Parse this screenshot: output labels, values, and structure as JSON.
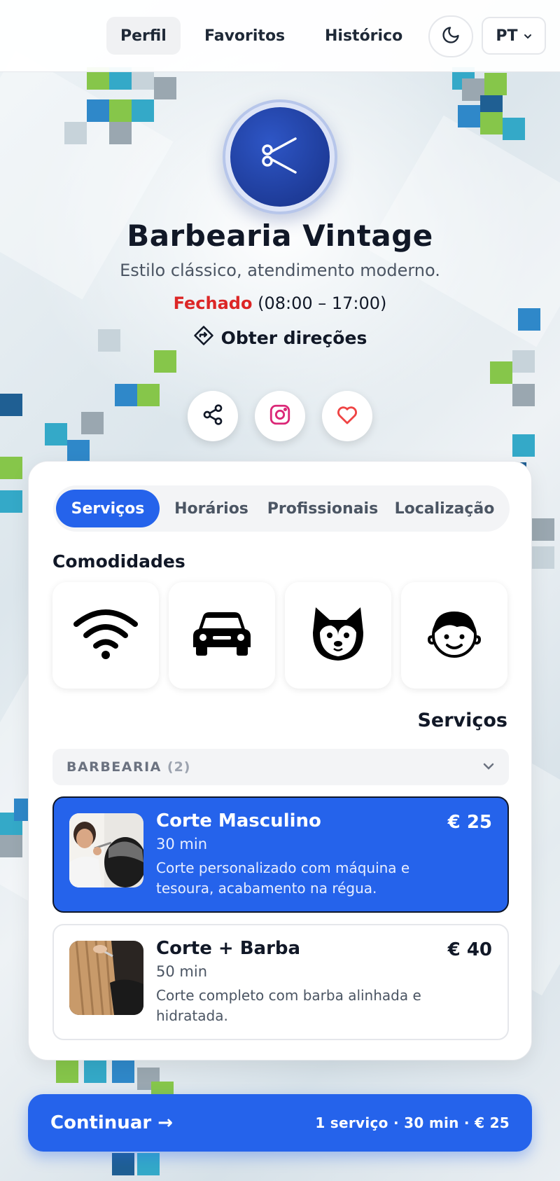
{
  "nav": {
    "items": [
      {
        "label": "Perfil",
        "active": true
      },
      {
        "label": "Favoritos",
        "active": false
      },
      {
        "label": "Histórico",
        "active": false
      }
    ],
    "theme_icon": "moon-icon",
    "language": "PT"
  },
  "business": {
    "name": "Barbearia Vintage",
    "tagline": "Estilo clássico, atendimento moderno.",
    "status": "Fechado",
    "hours": "(08:00 – 17:00)",
    "directions_label": "Obter direções",
    "logo_icon": "scissors-icon"
  },
  "actions": [
    {
      "icon": "share-icon"
    },
    {
      "icon": "instagram-icon"
    },
    {
      "icon": "heart-icon"
    }
  ],
  "tabs": [
    {
      "label": "Serviços",
      "active": true
    },
    {
      "label": "Horários",
      "active": false
    },
    {
      "label": "Profissionais",
      "active": false
    },
    {
      "label": "Localização",
      "active": false
    }
  ],
  "amenities": {
    "heading": "Comodidades",
    "items": [
      {
        "icon": "wifi-icon"
      },
      {
        "icon": "car-icon"
      },
      {
        "icon": "dog-icon"
      },
      {
        "icon": "child-icon"
      }
    ]
  },
  "services": {
    "heading": "Serviços",
    "category": {
      "name": "BARBEARIA",
      "count": "(2)"
    },
    "items": [
      {
        "name": "Corte Masculino",
        "duration": "30 min",
        "description": "Corte personalizado com máquina e tesoura, acabamento na régua.",
        "price": "€ 25",
        "selected": true
      },
      {
        "name": "Corte + Barba",
        "duration": "50 min",
        "description": "Corte completo com barba alinhada e hidratada.",
        "price": "€ 40",
        "selected": false
      }
    ]
  },
  "footer": {
    "continue_label": "Continuar →",
    "summary": "1 serviço · 30 min · € 25"
  },
  "colors": {
    "accent": "#2563eb",
    "closed": "#dc2626",
    "logo": "#1d3a96"
  }
}
